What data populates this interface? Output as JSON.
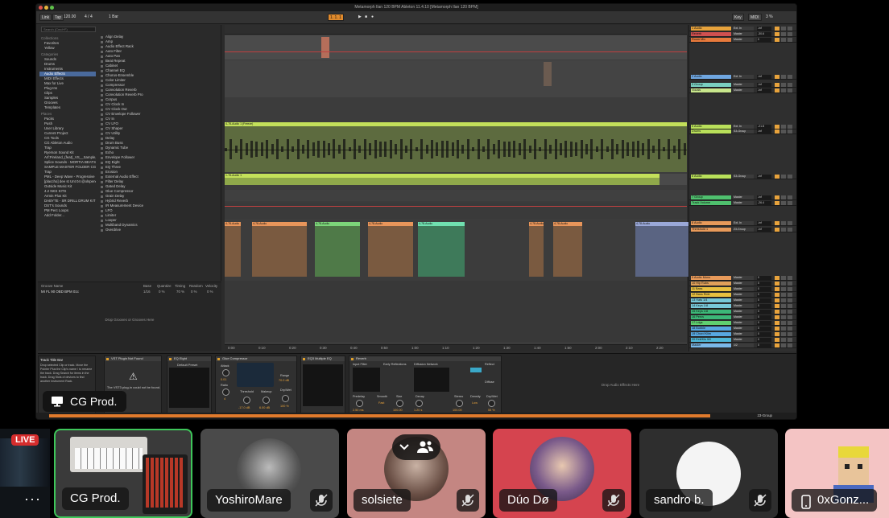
{
  "app": {
    "window_title": "Metamorph Ilan 120 BPM Ableton 11.4.10  [Metamorph Ilan 120 BPM]"
  },
  "control_bar": {
    "link": "Link",
    "tap": "Tap",
    "tempo": "120.00",
    "time_sig": "4 / 4",
    "quantize": "1 Bar",
    "position": "1. 1. 1",
    "key": "Key",
    "midi": "MIDI",
    "cpu": "3 %"
  },
  "browser": {
    "search_placeholder": "Search (Cmd+F)",
    "collections_header": "Collections",
    "collections": [
      "Favorites",
      "Yellow"
    ],
    "categories_header": "Categories",
    "categories": [
      "Sounds",
      "Drums",
      "Instruments",
      "Audio Effects",
      "MIDI Effects",
      "Max for Live",
      "Plug-Ins",
      "Clips",
      "Samples",
      "Grooves",
      "Templates"
    ],
    "places_header": "Places",
    "places": [
      "Packs",
      "Push",
      "User Library",
      "Current Project",
      "CG Tools",
      "CG Ableton Audio",
      "Trap",
      "Ryerson Sound Kit",
      "Arf:Fireland_(feat)_VS__Sample_Pl...",
      "Splice Sounds - MORTIA BEATS QUANT...",
      "SAMPLE MASTER FOLDER CG",
      "Trap",
      "PML - Deep Wave - Progressive Hou...",
      "[placcho] dee st Unt 04 @olspencer...",
      "Outside Music Kit",
      "4.2 NKS KITS",
      "Armin Plus Kit",
      "DABYTE - SR DRILL DRUM KIT",
      "DST's Sounds",
      "PM Perc Loops",
      "Add Folder..."
    ],
    "items": [
      "Align Delay",
      "Amp",
      "Audio Effect Rack",
      "Auto Filter",
      "Auto Pan",
      "Beat Repeat",
      "Cabinet",
      "Channel EQ",
      "Chorus-Ensemble",
      "Color Limiter",
      "Compressor",
      "Convolution Reverb",
      "Convolution Reverb Pro",
      "Corpus",
      "CV Clock In",
      "CV Clock Out",
      "CV Envelope Follower",
      "CV In",
      "CV LFO",
      "CV Shaper",
      "CV Utility",
      "Delay",
      "Drum Buss",
      "Dynamic Tube",
      "Echo",
      "Envelope Follower",
      "EQ Eight",
      "EQ Three",
      "Erosion",
      "External Audio Effect",
      "Filter Delay",
      "Gated Delay",
      "Glue Compressor",
      "Grain Delay",
      "Hybrid Reverb",
      "IR Measurement Device",
      "LFO",
      "Limiter",
      "Looper",
      "Multiband Dynamics",
      "Overdrive"
    ]
  },
  "groove_pool": {
    "headers": [
      "Groove Name",
      "Base",
      "Quantize",
      "Timing",
      "Random",
      "Velocity"
    ],
    "row": [
      "MI FL 90 OBD BPM 01c",
      "1/16",
      "0 %",
      "70 %",
      "0 %",
      "0 %"
    ],
    "drop_hint": "Drop Grooves or Grooves Here"
  },
  "arrangement": {
    "clip_label_a": "4-78-Audio 1 (Freeze)",
    "clip_label_b": "1-78-Audio 1",
    "clip_label_c": "4-78-Audio",
    "ruler_ticks": [
      "0:00",
      "0:10",
      "0:20",
      "0:30",
      "0:40",
      "0:50",
      "1:00",
      "1:10",
      "1:20",
      "1:30",
      "1:40",
      "1:50",
      "2:00",
      "2:10",
      "2:20"
    ]
  },
  "mixer": {
    "tracks": [
      {
        "name": "1 Audio",
        "color": "#e8a33c",
        "io": "Ext. In",
        "val": "-inf"
      },
      {
        "name": "Reverb",
        "color": "#d05050",
        "io": "Master",
        "val": "-30.6"
      },
      {
        "name": "Room Mic",
        "color": "#e87a3c",
        "io": "Master",
        "val": "0"
      },
      {
        "name": "2 Audio",
        "color": "#6fa6e0",
        "io": "Ext. In",
        "val": "-inf"
      },
      {
        "name": "3 Group",
        "color": "#7ad0c0",
        "io": "Master",
        "val": "-inf"
      },
      {
        "name": "Vocals",
        "color": "#c8e68c",
        "io": "Master",
        "val": "-inf"
      },
      {
        "name": "5 Audio",
        "color": "#b9e05a",
        "io": "Ext. In",
        "val": "-21.8"
      },
      {
        "name": "Drums",
        "color": "#b9e05a",
        "io": "S3-Group",
        "val": "-inf"
      },
      {
        "name": "6 Audio",
        "color": "#b9e05a",
        "io": "S3-Group",
        "val": "-inf"
      },
      {
        "name": "7 Group",
        "color": "#4fc06e",
        "io": "Master",
        "val": "-inf"
      },
      {
        "name": "Track Volume",
        "color": "#4fc06e",
        "io": "Master",
        "val": "-26.4"
      },
      {
        "name": "8 Audio",
        "color": "#e89a5a",
        "io": "Ext. In",
        "val": "-inf"
      },
      {
        "name": "Threshold 1",
        "color": "#e89a5a",
        "io": "23-Group",
        "val": "-inf"
      },
      {
        "name": "9 Audio Mono",
        "color": "#e89a5a",
        "io": "Master",
        "val": "0"
      },
      {
        "name": "10 Hip Rubs",
        "color": "#e0a05a",
        "io": "Master",
        "val": "0"
      },
      {
        "name": "11 Bass",
        "color": "#e8c040",
        "io": "Master",
        "val": "0"
      },
      {
        "name": "12 Bass Ride",
        "color": "#e8c040",
        "io": "Master",
        "val": "0"
      },
      {
        "name": "13 Hats 1/4",
        "color": "#78c8d8",
        "io": "Master",
        "val": "0"
      },
      {
        "name": "14 Keys 1/8",
        "color": "#78c8d8",
        "io": "Master",
        "val": "0"
      },
      {
        "name": "15 Keys 1/8",
        "color": "#3cb878",
        "io": "Master",
        "val": "0"
      },
      {
        "name": "16 Percs",
        "color": "#3cb878",
        "io": "Master",
        "val": "0"
      },
      {
        "name": "17 Ldgs",
        "color": "#60d070",
        "io": "Master",
        "val": "0"
      },
      {
        "name": "18 Bubble",
        "color": "#58a8e0",
        "io": "Master",
        "val": "0"
      },
      {
        "name": "19 Chord Klim",
        "color": "#58a8e0",
        "io": "Master",
        "val": "0"
      },
      {
        "name": "20 Exit/Kls Wt",
        "color": "#4fb8d8",
        "io": "Master",
        "val": "0"
      },
      {
        "name": "Master",
        "color": "#7ab8e8",
        "io": "1/2",
        "val": "0"
      }
    ]
  },
  "devices": {
    "info_title": "Track Title Bar",
    "info_text": "Drop selected Clip or track. Move the Pointer Plus the Clip's name / to rename the track. Drag Search for items in the track. Drag Slots of devices to find another Instrument Rack.",
    "plugin_missing_title": "VST Plugin Not Found",
    "plugin_missing_text": "The VST3 plug-in could not be found.",
    "eq_title": "EQ Eight",
    "eq_preset": "Default Preset",
    "comp_title": "Glue Compressor",
    "comp_labels": [
      "Attack",
      "Ratio",
      "Threshold",
      "Makeup",
      "Range",
      "Dry/Wet"
    ],
    "comp_values": [
      "0.01",
      "4",
      "-17.0 dB",
      "6.00 dB",
      "70.0 dB",
      "100 %"
    ],
    "eq3_title": "EQ3 Multiple EQ",
    "reverb_title": "Reverb",
    "reverb_sections": [
      "Input Filter",
      "Early Reflections",
      "Diffusion Network",
      "Reflect",
      "Diffuse"
    ],
    "reverb_labels": [
      "Predelay",
      "Smooth",
      "Size",
      "Decay",
      "Stereo",
      "Density",
      "Dry/Wet"
    ],
    "reverb_values": [
      "2.50 ms",
      "Fast",
      "100.00",
      "1.20 s",
      "100.00",
      "Low",
      "55 %"
    ],
    "drop_hint": "Drop Audio Effects Here"
  },
  "status": {
    "group": "23-Group"
  },
  "presenter": {
    "label": "CG Prod."
  },
  "call": {
    "live_badge": "LIVE",
    "more_label": "···",
    "participants": [
      {
        "name": "CG Prod.",
        "muted": false
      },
      {
        "name": "YoshiroMare",
        "muted": true
      },
      {
        "name": "solsiete",
        "muted": true
      },
      {
        "name": "Dúo Dø",
        "muted": true
      },
      {
        "name": "sandro b.",
        "muted": true
      },
      {
        "name": "0xGonz...",
        "muted": false
      }
    ]
  },
  "colors": {
    "accent": "#e07a2c",
    "speaking_border": "#3ec65a",
    "tile_pink": "#c48682",
    "tile_red": "#d5444f"
  }
}
